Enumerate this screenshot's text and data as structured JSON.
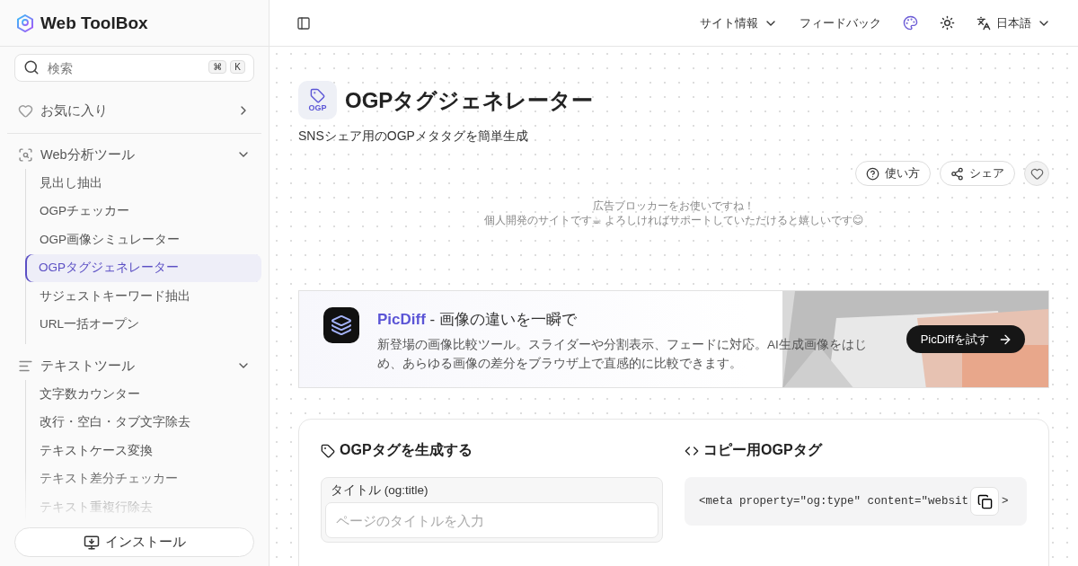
{
  "sidebar": {
    "logo": "Web ToolBox",
    "search": {
      "placeholder": "検索",
      "keys": [
        "⌘",
        "K"
      ]
    },
    "favorites": {
      "label": "お気に入り"
    },
    "groups": [
      {
        "label": "Web分析ツール",
        "kind": "web",
        "expanded": true,
        "children": [
          {
            "label": "見出し抽出",
            "selected": false
          },
          {
            "label": "OGPチェッカー",
            "selected": false
          },
          {
            "label": "OGP画像シミュレーター",
            "selected": false
          },
          {
            "label": "OGPタグジェネレーター",
            "selected": true
          },
          {
            "label": "サジェストキーワード抽出",
            "selected": false
          },
          {
            "label": "URL一括オープン",
            "selected": false
          }
        ]
      },
      {
        "label": "テキストツール",
        "kind": "text",
        "expanded": true,
        "children": [
          {
            "label": "文字数カウンター",
            "selected": false
          },
          {
            "label": "改行・空白・タブ文字除去",
            "selected": false
          },
          {
            "label": "テキストケース変換",
            "selected": false
          },
          {
            "label": "テキスト差分チェッカー",
            "selected": false
          },
          {
            "label": "テキスト重複行除去",
            "selected": false
          }
        ]
      }
    ],
    "install": "インストール"
  },
  "header": {
    "menu": [
      {
        "label": "サイト情報",
        "kind": "dropdown"
      },
      {
        "label": "フィードバック",
        "kind": "link"
      }
    ],
    "language": "日本語"
  },
  "page": {
    "icon_text": "OGP",
    "title": "OGPタグジェネレーター",
    "subtitle": "SNSシェア用のOGPメタタグを簡単生成",
    "actions": [
      {
        "label": "使い方",
        "kind": "help"
      },
      {
        "label": "シェア",
        "kind": "share"
      }
    ],
    "favorite": {
      "selected": false
    },
    "adblock": [
      "広告ブロッカーをお使いですね！",
      "個人開発のサイトです☕ よろしければサポートしていただけると嬉しいです😊"
    ]
  },
  "banner": {
    "name": "PicDiff",
    "tagline": " - 画像の違いを一瞬で",
    "description": "新登場の画像比較ツール。スライダーや分割表示、フェードに対応。AI生成画像をはじめ、あらゆる画像の差分をブラウザ上で直感的に比較できます。",
    "button": "PicDiffを試す"
  },
  "form": {
    "heading": "OGPタグを生成する",
    "field": {
      "label": "タイトル (og:title)",
      "placeholder": "ページのタイトルを入力"
    }
  },
  "output": {
    "heading": "コピー用OGPタグ",
    "code": "<meta property=\"og:type\" content=\"websit",
    "code_tail": ">"
  }
}
